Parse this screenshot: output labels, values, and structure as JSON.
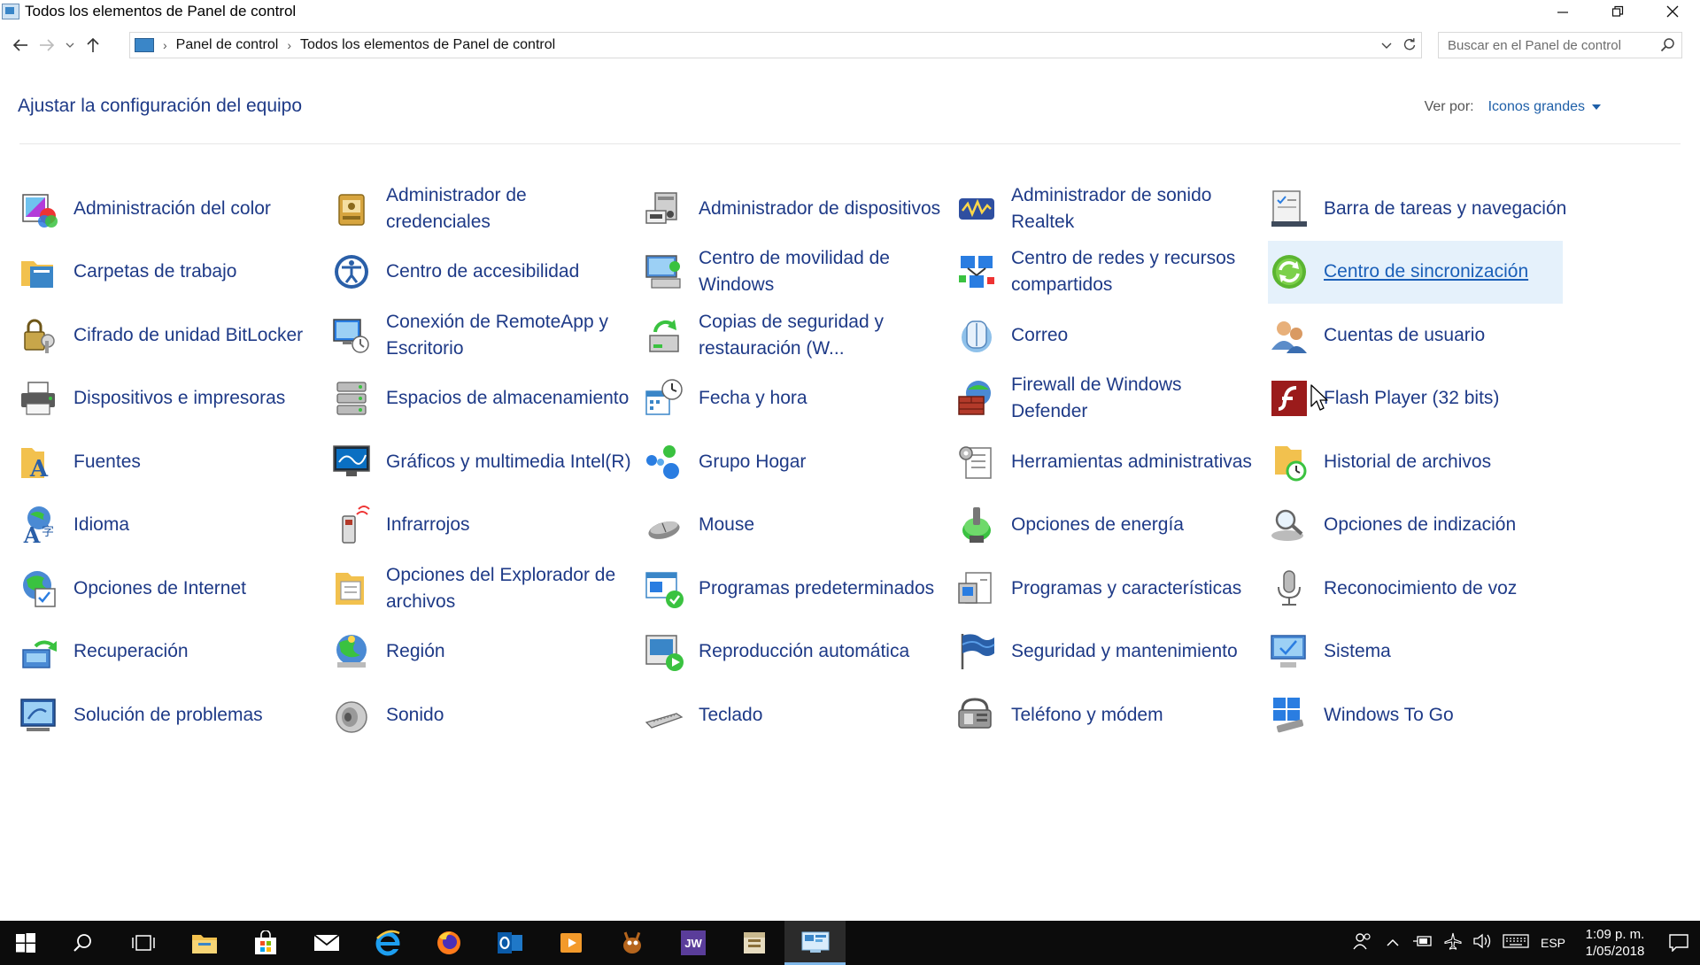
{
  "window": {
    "title": "Todos los elementos de Panel de control"
  },
  "navigation": {
    "breadcrumb": [
      "Panel de control",
      "Todos los elementos de Panel de control"
    ],
    "search_placeholder": "Buscar en el Panel de control"
  },
  "header": {
    "heading": "Ajustar la configuración del equipo",
    "view_by_label": "Ver por:",
    "view_by_value": "Iconos grandes"
  },
  "items": [
    {
      "label": "Administración del color",
      "icon": "color-management-icon"
    },
    {
      "label": "Administrador de credenciales",
      "icon": "credential-manager-icon"
    },
    {
      "label": "Administrador de dispositivos",
      "icon": "device-manager-icon"
    },
    {
      "label": "Administrador de sonido Realtek",
      "icon": "realtek-audio-icon"
    },
    {
      "label": "Barra de tareas y navegación",
      "icon": "taskbar-icon"
    },
    {
      "label": "Carpetas de trabajo",
      "icon": "work-folders-icon"
    },
    {
      "label": "Centro de accesibilidad",
      "icon": "accessibility-icon"
    },
    {
      "label": "Centro de movilidad de Windows",
      "icon": "mobility-center-icon"
    },
    {
      "label": "Centro de redes y recursos compartidos",
      "icon": "network-center-icon"
    },
    {
      "label": "Centro de sincronización",
      "icon": "sync-center-icon"
    },
    {
      "label": "Cifrado de unidad BitLocker",
      "icon": "bitlocker-icon"
    },
    {
      "label": "Conexión de RemoteApp y Escritorio",
      "icon": "remoteapp-icon"
    },
    {
      "label": "Copias de seguridad y restauración (W...",
      "icon": "backup-restore-icon"
    },
    {
      "label": "Correo",
      "icon": "mail-icon"
    },
    {
      "label": "Cuentas de usuario",
      "icon": "user-accounts-icon"
    },
    {
      "label": "Dispositivos e impresoras",
      "icon": "printer-icon"
    },
    {
      "label": "Espacios de almacenamiento",
      "icon": "storage-spaces-icon"
    },
    {
      "label": "Fecha y hora",
      "icon": "date-time-icon"
    },
    {
      "label": "Firewall de Windows Defender",
      "icon": "firewall-icon"
    },
    {
      "label": "Flash Player (32 bits)",
      "icon": "flash-player-icon"
    },
    {
      "label": "Fuentes",
      "icon": "fonts-icon"
    },
    {
      "label": "Gráficos y multimedia Intel(R)",
      "icon": "intel-graphics-icon"
    },
    {
      "label": "Grupo Hogar",
      "icon": "homegroup-icon"
    },
    {
      "label": "Herramientas administrativas",
      "icon": "admin-tools-icon"
    },
    {
      "label": "Historial de archivos",
      "icon": "file-history-icon"
    },
    {
      "label": "Idioma",
      "icon": "language-icon"
    },
    {
      "label": "Infrarrojos",
      "icon": "infrared-icon"
    },
    {
      "label": "Mouse",
      "icon": "mouse-icon"
    },
    {
      "label": "Opciones de energía",
      "icon": "power-options-icon"
    },
    {
      "label": "Opciones de indización",
      "icon": "indexing-icon"
    },
    {
      "label": "Opciones de Internet",
      "icon": "internet-options-icon"
    },
    {
      "label": "Opciones del Explorador de archivos",
      "icon": "explorer-options-icon"
    },
    {
      "label": "Programas predeterminados",
      "icon": "default-programs-icon"
    },
    {
      "label": "Programas y características",
      "icon": "programs-features-icon"
    },
    {
      "label": "Reconocimiento de voz",
      "icon": "microphone-icon"
    },
    {
      "label": "Recuperación",
      "icon": "recovery-icon"
    },
    {
      "label": "Región",
      "icon": "region-icon"
    },
    {
      "label": "Reproducción automática",
      "icon": "autoplay-icon"
    },
    {
      "label": "Seguridad y mantenimiento",
      "icon": "security-flag-icon"
    },
    {
      "label": "Sistema",
      "icon": "system-icon"
    },
    {
      "label": "Solución de problemas",
      "icon": "troubleshooting-icon"
    },
    {
      "label": "Sonido",
      "icon": "sound-icon"
    },
    {
      "label": "Teclado",
      "icon": "keyboard-icon"
    },
    {
      "label": "Teléfono y módem",
      "icon": "phone-modem-icon"
    },
    {
      "label": "Windows To Go",
      "icon": "windows-to-go-icon"
    }
  ],
  "active_item_index": 9,
  "taskbar": {
    "apps": [
      "start-icon",
      "search-icon",
      "task-view-icon",
      "file-explorer-icon",
      "store-icon",
      "mail-icon",
      "edge-icon",
      "firefox-icon",
      "outlook-icon",
      "media-player-icon",
      "gimp-icon",
      "jw-icon",
      "archive-icon",
      "control-panel-icon"
    ],
    "language": "ESP",
    "time": "1:09 p. m.",
    "date": "1/05/2018"
  }
}
